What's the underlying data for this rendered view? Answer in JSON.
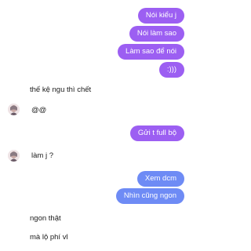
{
  "sent": [
    {
      "text": "Nói kiểu j"
    },
    {
      "text": "Nói làm sao"
    },
    {
      "text": "Làm sao để nói"
    },
    {
      "text": ":)))"
    },
    {
      "text": "Gửi t full bộ"
    },
    {
      "text": "Xem dcm"
    },
    {
      "text": "Nhìn cũng ngon"
    }
  ],
  "received": [
    {
      "text": "thế kệ ngu thì chết"
    },
    {
      "text": "@@"
    },
    {
      "text": "làm j ?"
    },
    {
      "text": "ngon thật"
    },
    {
      "text": "mà lộ phí vl"
    }
  ],
  "colors": {
    "sent_purple": "#9c5ff2",
    "sent_blue": "#6e8bf5"
  },
  "avatar": {
    "icon": "contact-avatar"
  }
}
